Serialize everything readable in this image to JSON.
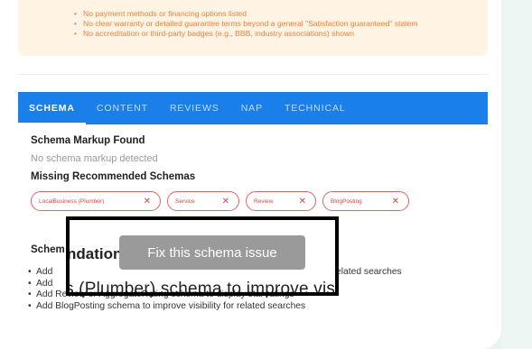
{
  "issues": {
    "items": [
      "No payment methods or financing options listed",
      "No clear warranty or detailed guarantee terms beyond a general \"Satisfaction guaranteed\" statem",
      "No accreditation or third-party badges (e.g., BBB, industry associations) shown"
    ]
  },
  "tabs": [
    "SCHEMA",
    "CONTENT",
    "REVIEWS",
    "NAP",
    "TECHNICAL"
  ],
  "schema": {
    "found_title": "Schema Markup Found",
    "found_text": "No schema markup detected",
    "missing_title": "Missing Recommended Schemas",
    "missing_items": [
      "LocalBusiness (Plumber)",
      "Service",
      "Review",
      "BlogPosting"
    ],
    "remove_icon": "close-icon",
    "recommendations_title": "Schem",
    "recommendations_overlay_heading": "ndations",
    "recommendations_overlay_text": "s (Plumber) schema to improve visi",
    "recommendations": [
      "Add",
      "Add",
      "Add Review or AggregateRating schema to display star ratings",
      "Add BlogPosting schema to improve visibility for related searches"
    ],
    "recommendation_tail": "elated searches"
  },
  "tooltip": {
    "text": "Fix this schema issue"
  },
  "colors": {
    "tab_bar": "#1a7fe8",
    "warning_bg": "#fff3e4",
    "warning_text": "#e8833a",
    "chip_border": "#e06262",
    "page_bg": "#e9f3ef"
  }
}
